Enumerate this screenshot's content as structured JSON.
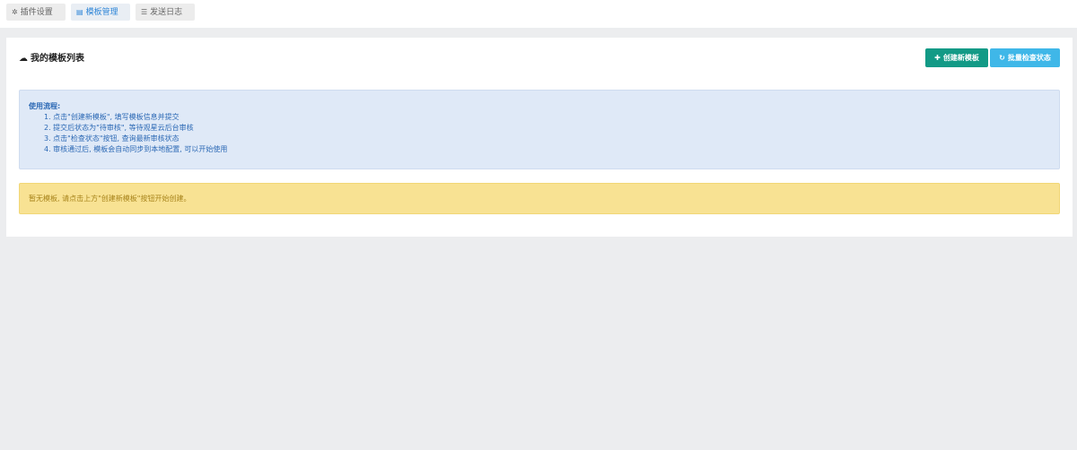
{
  "tabs": [
    {
      "label": "插件设置",
      "icon": "gear-icon",
      "glyph": "✲",
      "active": false
    },
    {
      "label": "模板管理",
      "icon": "document-icon",
      "glyph": "▤",
      "active": true
    },
    {
      "label": "发送日志",
      "icon": "list-icon",
      "glyph": "☰",
      "active": false
    }
  ],
  "panel": {
    "title": "我的模板列表",
    "title_icon": "cloud-icon",
    "title_glyph": "☁",
    "buttons": {
      "create": {
        "label": "创建新模板",
        "glyph": "✚",
        "icon": "plus-icon",
        "color": "#129a86"
      },
      "check": {
        "label": "批量检查状态",
        "glyph": "↻",
        "icon": "refresh-icon",
        "color": "#3fb7e8"
      }
    }
  },
  "info": {
    "heading": "使用流程:",
    "steps": [
      "1. 点击\"创建新模板\", 填写模板信息并提交",
      "2. 提交后状态为\"待审核\", 等待观星云后台审核",
      "3. 点击\"检查状态\"按钮, 查询最新审核状态",
      "4. 审核通过后, 模板会自动同步到本地配置, 可以开始使用"
    ]
  },
  "empty_notice": "暂无模板, 请点击上方\"创建新模板\"按钮开始创建。",
  "colors": {
    "accent": "#2f86d8",
    "info_bg": "#dfe9f7",
    "warn_bg": "#f8e293"
  }
}
